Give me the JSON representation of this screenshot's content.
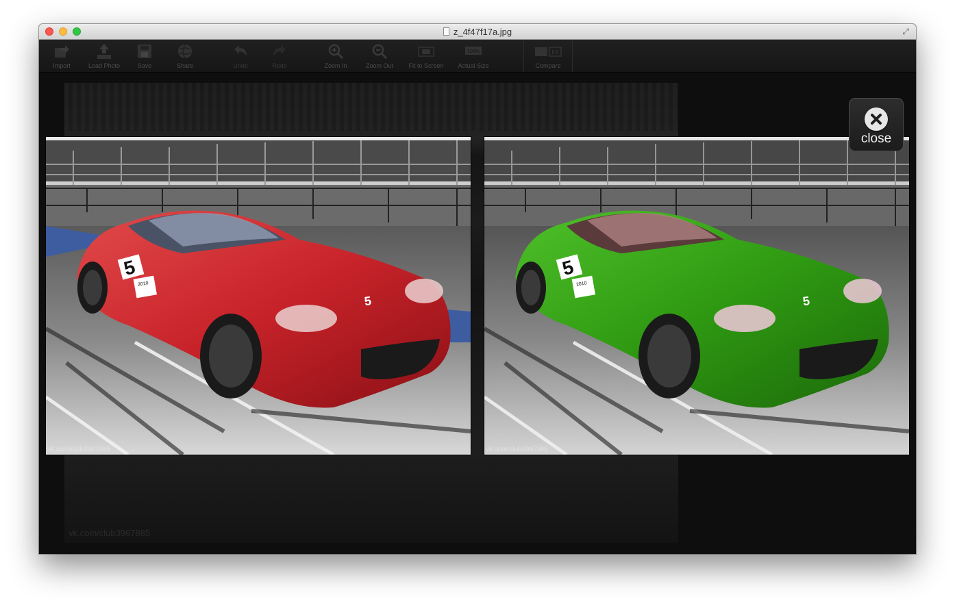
{
  "window": {
    "title": "z_4f47f17a.jpg"
  },
  "toolbar": {
    "items": [
      {
        "label": "Import",
        "icon": "import-icon"
      },
      {
        "label": "Load Photo",
        "icon": "load-photo-icon"
      },
      {
        "label": "Save",
        "icon": "save-icon"
      },
      {
        "label": "Share",
        "icon": "share-icon"
      },
      {
        "label": "Undo",
        "icon": "undo-icon"
      },
      {
        "label": "Redo",
        "icon": "redo-icon"
      },
      {
        "label": "Zoom In",
        "icon": "zoom-in-icon"
      },
      {
        "label": "Zoom Out",
        "icon": "zoom-out-icon"
      },
      {
        "label": "Fit to Screen",
        "icon": "fit-to-screen-icon"
      },
      {
        "label": "Actual Size",
        "icon": "actual-size-icon",
        "badge": "100%"
      },
      {
        "label": "Compare",
        "icon": "compare-icon",
        "badge": "FX"
      }
    ]
  },
  "compare": {
    "before_color": "#c8232a",
    "after_color": "#2f9a12",
    "watermark": "vk.com/club3967885",
    "car_number": "5",
    "car_sticker": "2010"
  },
  "close_button": {
    "label": "close"
  }
}
